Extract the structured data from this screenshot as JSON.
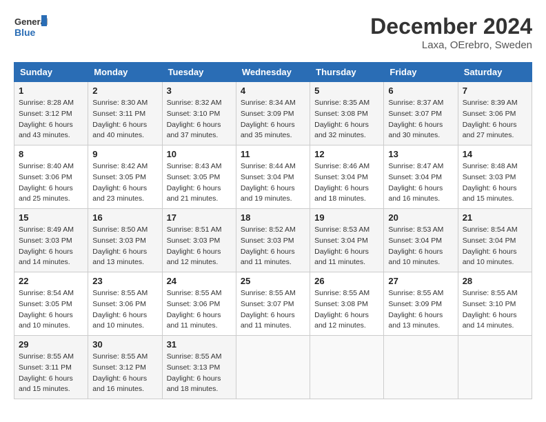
{
  "header": {
    "logo_line1": "General",
    "logo_line2": "Blue",
    "title": "December 2024",
    "subtitle": "Laxa, OErebro, Sweden"
  },
  "days_of_week": [
    "Sunday",
    "Monday",
    "Tuesday",
    "Wednesday",
    "Thursday",
    "Friday",
    "Saturday"
  ],
  "weeks": [
    [
      {
        "day": 1,
        "sunrise": "Sunrise: 8:28 AM",
        "sunset": "Sunset: 3:12 PM",
        "daylight": "Daylight: 6 hours and 43 minutes."
      },
      {
        "day": 2,
        "sunrise": "Sunrise: 8:30 AM",
        "sunset": "Sunset: 3:11 PM",
        "daylight": "Daylight: 6 hours and 40 minutes."
      },
      {
        "day": 3,
        "sunrise": "Sunrise: 8:32 AM",
        "sunset": "Sunset: 3:10 PM",
        "daylight": "Daylight: 6 hours and 37 minutes."
      },
      {
        "day": 4,
        "sunrise": "Sunrise: 8:34 AM",
        "sunset": "Sunset: 3:09 PM",
        "daylight": "Daylight: 6 hours and 35 minutes."
      },
      {
        "day": 5,
        "sunrise": "Sunrise: 8:35 AM",
        "sunset": "Sunset: 3:08 PM",
        "daylight": "Daylight: 6 hours and 32 minutes."
      },
      {
        "day": 6,
        "sunrise": "Sunrise: 8:37 AM",
        "sunset": "Sunset: 3:07 PM",
        "daylight": "Daylight: 6 hours and 30 minutes."
      },
      {
        "day": 7,
        "sunrise": "Sunrise: 8:39 AM",
        "sunset": "Sunset: 3:06 PM",
        "daylight": "Daylight: 6 hours and 27 minutes."
      }
    ],
    [
      {
        "day": 8,
        "sunrise": "Sunrise: 8:40 AM",
        "sunset": "Sunset: 3:06 PM",
        "daylight": "Daylight: 6 hours and 25 minutes."
      },
      {
        "day": 9,
        "sunrise": "Sunrise: 8:42 AM",
        "sunset": "Sunset: 3:05 PM",
        "daylight": "Daylight: 6 hours and 23 minutes."
      },
      {
        "day": 10,
        "sunrise": "Sunrise: 8:43 AM",
        "sunset": "Sunset: 3:05 PM",
        "daylight": "Daylight: 6 hours and 21 minutes."
      },
      {
        "day": 11,
        "sunrise": "Sunrise: 8:44 AM",
        "sunset": "Sunset: 3:04 PM",
        "daylight": "Daylight: 6 hours and 19 minutes."
      },
      {
        "day": 12,
        "sunrise": "Sunrise: 8:46 AM",
        "sunset": "Sunset: 3:04 PM",
        "daylight": "Daylight: 6 hours and 18 minutes."
      },
      {
        "day": 13,
        "sunrise": "Sunrise: 8:47 AM",
        "sunset": "Sunset: 3:04 PM",
        "daylight": "Daylight: 6 hours and 16 minutes."
      },
      {
        "day": 14,
        "sunrise": "Sunrise: 8:48 AM",
        "sunset": "Sunset: 3:03 PM",
        "daylight": "Daylight: 6 hours and 15 minutes."
      }
    ],
    [
      {
        "day": 15,
        "sunrise": "Sunrise: 8:49 AM",
        "sunset": "Sunset: 3:03 PM",
        "daylight": "Daylight: 6 hours and 14 minutes."
      },
      {
        "day": 16,
        "sunrise": "Sunrise: 8:50 AM",
        "sunset": "Sunset: 3:03 PM",
        "daylight": "Daylight: 6 hours and 13 minutes."
      },
      {
        "day": 17,
        "sunrise": "Sunrise: 8:51 AM",
        "sunset": "Sunset: 3:03 PM",
        "daylight": "Daylight: 6 hours and 12 minutes."
      },
      {
        "day": 18,
        "sunrise": "Sunrise: 8:52 AM",
        "sunset": "Sunset: 3:03 PM",
        "daylight": "Daylight: 6 hours and 11 minutes."
      },
      {
        "day": 19,
        "sunrise": "Sunrise: 8:53 AM",
        "sunset": "Sunset: 3:04 PM",
        "daylight": "Daylight: 6 hours and 11 minutes."
      },
      {
        "day": 20,
        "sunrise": "Sunrise: 8:53 AM",
        "sunset": "Sunset: 3:04 PM",
        "daylight": "Daylight: 6 hours and 10 minutes."
      },
      {
        "day": 21,
        "sunrise": "Sunrise: 8:54 AM",
        "sunset": "Sunset: 3:04 PM",
        "daylight": "Daylight: 6 hours and 10 minutes."
      }
    ],
    [
      {
        "day": 22,
        "sunrise": "Sunrise: 8:54 AM",
        "sunset": "Sunset: 3:05 PM",
        "daylight": "Daylight: 6 hours and 10 minutes."
      },
      {
        "day": 23,
        "sunrise": "Sunrise: 8:55 AM",
        "sunset": "Sunset: 3:06 PM",
        "daylight": "Daylight: 6 hours and 10 minutes."
      },
      {
        "day": 24,
        "sunrise": "Sunrise: 8:55 AM",
        "sunset": "Sunset: 3:06 PM",
        "daylight": "Daylight: 6 hours and 11 minutes."
      },
      {
        "day": 25,
        "sunrise": "Sunrise: 8:55 AM",
        "sunset": "Sunset: 3:07 PM",
        "daylight": "Daylight: 6 hours and 11 minutes."
      },
      {
        "day": 26,
        "sunrise": "Sunrise: 8:55 AM",
        "sunset": "Sunset: 3:08 PM",
        "daylight": "Daylight: 6 hours and 12 minutes."
      },
      {
        "day": 27,
        "sunrise": "Sunrise: 8:55 AM",
        "sunset": "Sunset: 3:09 PM",
        "daylight": "Daylight: 6 hours and 13 minutes."
      },
      {
        "day": 28,
        "sunrise": "Sunrise: 8:55 AM",
        "sunset": "Sunset: 3:10 PM",
        "daylight": "Daylight: 6 hours and 14 minutes."
      }
    ],
    [
      {
        "day": 29,
        "sunrise": "Sunrise: 8:55 AM",
        "sunset": "Sunset: 3:11 PM",
        "daylight": "Daylight: 6 hours and 15 minutes."
      },
      {
        "day": 30,
        "sunrise": "Sunrise: 8:55 AM",
        "sunset": "Sunset: 3:12 PM",
        "daylight": "Daylight: 6 hours and 16 minutes."
      },
      {
        "day": 31,
        "sunrise": "Sunrise: 8:55 AM",
        "sunset": "Sunset: 3:13 PM",
        "daylight": "Daylight: 6 hours and 18 minutes."
      },
      null,
      null,
      null,
      null
    ]
  ]
}
